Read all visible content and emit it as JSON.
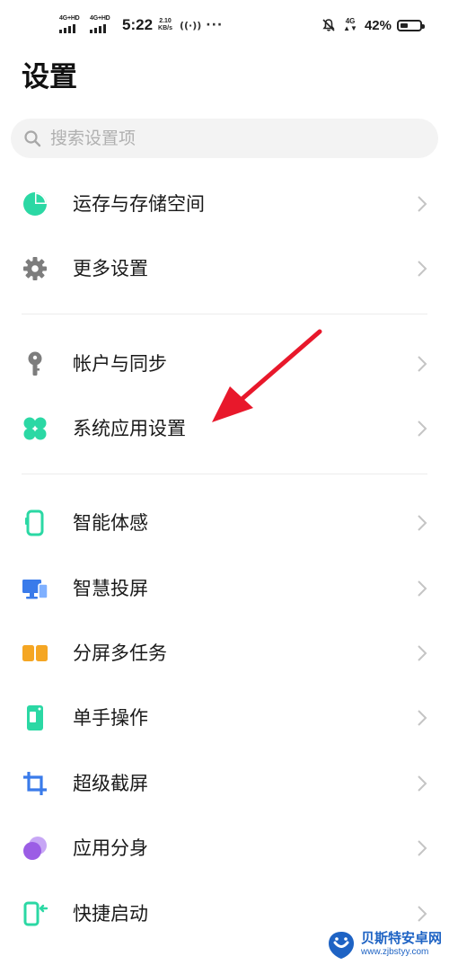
{
  "status_bar": {
    "sim1_tag": "4G+HD",
    "sim2_tag": "4G+HD",
    "time": "5:22",
    "speed_value": "2.10",
    "speed_unit": "KB/s",
    "more": "···",
    "network_tag": "4G",
    "battery_percent": "42%",
    "battery_level": 0.42,
    "icons": [
      "signal-icon",
      "hotspot-icon",
      "mute-icon",
      "battery-icon"
    ]
  },
  "page": {
    "title": "设置"
  },
  "search": {
    "placeholder": "搜索设置项"
  },
  "items": [
    {
      "label": "运存与存储空间",
      "icon": "storage-pie-icon",
      "color": "#2bd8a4"
    },
    {
      "label": "更多设置",
      "icon": "gear-icon",
      "color": "#7d7d7d"
    },
    {
      "label": "帐户与同步",
      "icon": "key-icon",
      "color": "#7d7d7d"
    },
    {
      "label": "系统应用设置",
      "icon": "apps-grid-icon",
      "color": "#2bd8a4"
    },
    {
      "label": "智能体感",
      "icon": "phone-motion-icon",
      "color": "#2bd8a4"
    },
    {
      "label": "智慧投屏",
      "icon": "screen-cast-icon",
      "color": "#3a7bea"
    },
    {
      "label": "分屏多任务",
      "icon": "split-screen-icon",
      "color": "#f5a623"
    },
    {
      "label": "单手操作",
      "icon": "one-hand-icon",
      "color": "#2bd8a4"
    },
    {
      "label": "超级截屏",
      "icon": "screenshot-crop-icon",
      "color": "#3a7bea"
    },
    {
      "label": "应用分身",
      "icon": "app-clone-icon",
      "color": "#9b5de5"
    },
    {
      "label": "快捷启动",
      "icon": "quick-launch-icon",
      "color": "#2bd8a4"
    }
  ],
  "watermark": {
    "name": "贝斯特安卓网",
    "url": "www.zjbstyy.com"
  },
  "colors": {
    "accent_green": "#2bd8a4",
    "accent_blue": "#3a7bea",
    "accent_orange": "#f5a623",
    "accent_purple": "#9b5de5",
    "annotation_red": "#e8182b"
  }
}
